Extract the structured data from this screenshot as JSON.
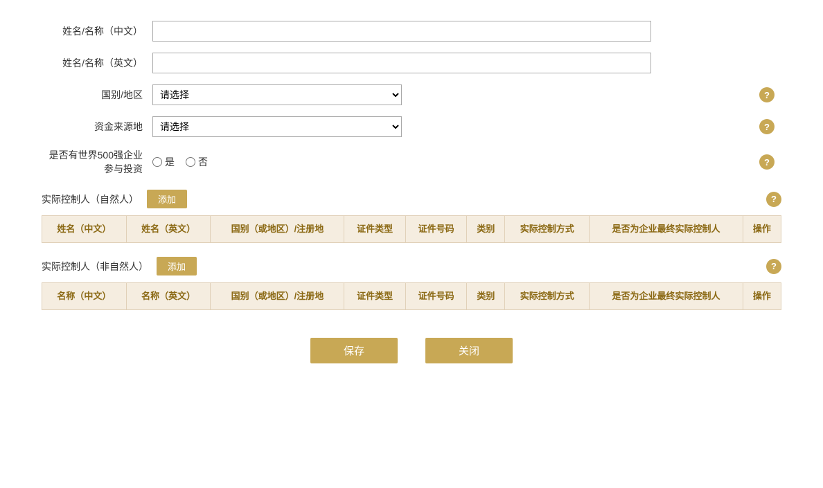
{
  "form": {
    "name_cn_label": "姓名/名称（中文）",
    "name_en_label": "姓名/名称（英文）",
    "country_label": "国别/地区",
    "fund_source_label": "资金来源地",
    "fortune500_label": "是否有世界500强企业参与投资",
    "name_cn_value": "",
    "name_en_value": "",
    "country_placeholder": "请选择",
    "fund_source_placeholder": "请选择",
    "radio_yes": "是",
    "radio_no": "否"
  },
  "natural_person_section": {
    "title": "实际控制人（自然人）",
    "add_button": "添加",
    "columns": [
      "姓名（中文）",
      "姓名（英文）",
      "国别（或地区）/注册地",
      "证件类型",
      "证件号码",
      "类别",
      "实际控制方式",
      "是否为企业最终实际控制人",
      "操作"
    ]
  },
  "non_natural_person_section": {
    "title": "实际控制人（非自然人）",
    "add_button": "添加",
    "columns": [
      "名称（中文）",
      "名称（英文）",
      "国别（或地区）/注册地",
      "证件类型",
      "证件号码",
      "类别",
      "实际控制方式",
      "是否为企业最终实际控制人",
      "操作"
    ]
  },
  "buttons": {
    "save": "保存",
    "close": "关闭"
  },
  "help_icon": "?",
  "colors": {
    "gold": "#c8a855",
    "table_header_bg": "#f5ede0",
    "table_header_text": "#8b6914",
    "table_border": "#e0d0b8"
  }
}
